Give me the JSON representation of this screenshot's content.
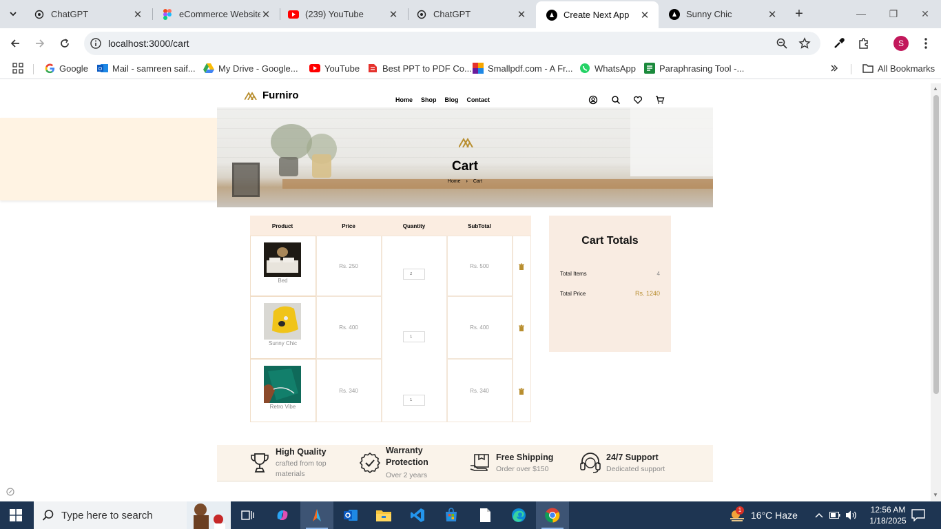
{
  "browser": {
    "tabs": [
      {
        "title": "ChatGPT",
        "icon": "chatgpt-icon"
      },
      {
        "title": "eCommerce Website",
        "icon": "figma-icon"
      },
      {
        "title": "(239) YouTube",
        "icon": "youtube-icon"
      },
      {
        "title": "ChatGPT",
        "icon": "chatgpt-icon"
      },
      {
        "title": "Create Next App",
        "icon": "nextjs-icon",
        "active": true
      },
      {
        "title": "Sunny Chic",
        "icon": "nextjs-icon"
      }
    ],
    "url": "localhost:3000/cart",
    "profile_initial": "S",
    "bookmarks": [
      {
        "label": "Google",
        "icon": "google-icon"
      },
      {
        "label": "Mail - samreen saif...",
        "icon": "outlook-icon"
      },
      {
        "label": "My Drive - Google...",
        "icon": "drive-icon"
      },
      {
        "label": "YouTube",
        "icon": "youtube-icon"
      },
      {
        "label": "Best PPT to PDF Co...",
        "icon": "ilovepdf-icon"
      },
      {
        "label": "Smallpdf.com - A Fr...",
        "icon": "smallpdf-icon"
      },
      {
        "label": "WhatsApp",
        "icon": "whatsapp-icon"
      },
      {
        "label": "Paraphrasing Tool -...",
        "icon": "quillbot-icon"
      }
    ],
    "all_bookmarks": "All Bookmarks"
  },
  "site": {
    "brand": "Furniro",
    "nav": [
      "Home",
      "Shop",
      "Blog",
      "Contact"
    ],
    "accent": "#b88e2f"
  },
  "hero": {
    "title": "Cart",
    "breadcrumb": [
      "Home",
      "Cart"
    ]
  },
  "cart": {
    "headers": [
      "Product",
      "Price",
      "Quantity",
      "SubTotal"
    ],
    "items": [
      {
        "name": "Bed",
        "price": "Rs. 250",
        "quantity": "2",
        "subtotal": "Rs. 500"
      },
      {
        "name": "Sunny Chic",
        "price": "Rs. 400",
        "quantity": "1",
        "subtotal": "Rs. 400"
      },
      {
        "name": "Retro Vibe",
        "price": "Rs. 340",
        "quantity": "1",
        "subtotal": "Rs. 340"
      }
    ]
  },
  "totals": {
    "title": "Cart Totals",
    "items_label": "Total Items",
    "items_value": "4",
    "price_label": "Total Price",
    "price_value": "Rs. 1240"
  },
  "features": [
    {
      "title": "High Quality",
      "subtitle": "crafted from top materials",
      "icon": "trophy-icon"
    },
    {
      "title": "Warranty Protection",
      "subtitle": "Over 2 years",
      "icon": "warranty-check-icon"
    },
    {
      "title": "Free Shipping",
      "subtitle": "Order over $150",
      "icon": "shipping-box-icon"
    },
    {
      "title": "24/7 Support",
      "subtitle": "Dedicated support",
      "icon": "support-headset-icon"
    }
  ],
  "taskbar": {
    "search_placeholder": "Type here to search",
    "weather": "16°C  Haze",
    "time": "12:56 AM",
    "date": "1/18/2025",
    "weather_badge": "1"
  }
}
